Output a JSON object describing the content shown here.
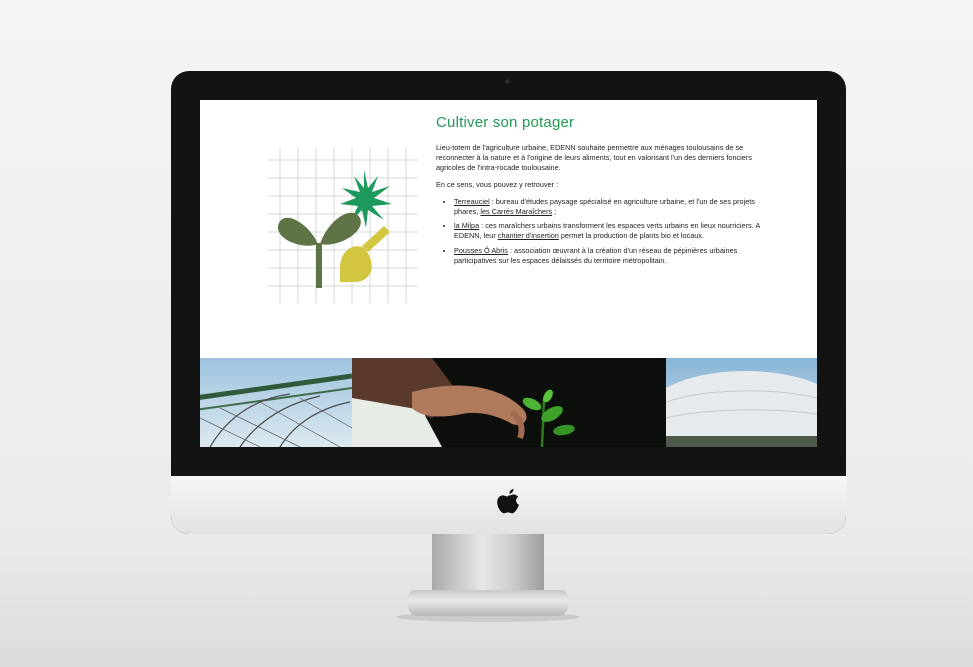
{
  "page": {
    "title": "Cultiver son potager",
    "intro": "Lieu-totem de l'agriculture urbaine, EDENN souhaite permettre aux ménages toulousains de se reconnecter à la nature et à l'origine de leurs aliments, tout en valorisant l'un des derniers fonciers agricoles de l'intra-rocade toulousaine.",
    "lead": "En ce sens, vous pouvez y retrouver :",
    "items": [
      {
        "link": "Terreauciel",
        "text1": " : bureau d'études paysage spécialisé en agriculture urbaine, et l'un de ses projets phares, ",
        "link2": "les Carrés Maraîchers",
        "text2": " ;"
      },
      {
        "link": "la Milpa",
        "text1": " : ces maraîchers urbains transforment les espaces verts urbains en lieux nourriciers. A EDENN, leur ",
        "link2": "chantier d'insertion",
        "text2": " permet la production de plants bio et locaux."
      },
      {
        "link": "Pousses Ô Abris",
        "text1": " : association œuvrant à la création d'un réseau de pépinières urbaines participatives sur les espaces délaissés du territoire métropolitain.",
        "link2": "",
        "text2": ""
      }
    ]
  },
  "illustration": {
    "icons": [
      "grid-icon",
      "sprout-icon",
      "spark-icon",
      "trowel-icon"
    ],
    "colors": {
      "sprout": "#5f7446",
      "spark": "#1d9a5b",
      "trowel": "#d3c640",
      "grid": "#c9cfc4"
    }
  },
  "photos": [
    "greenhouse-frame-photo",
    "hand-planting-photo",
    "polytunnel-photo"
  ],
  "colors": {
    "accent": "#1f9a55",
    "bezel": "#131313",
    "text": "#222222"
  }
}
